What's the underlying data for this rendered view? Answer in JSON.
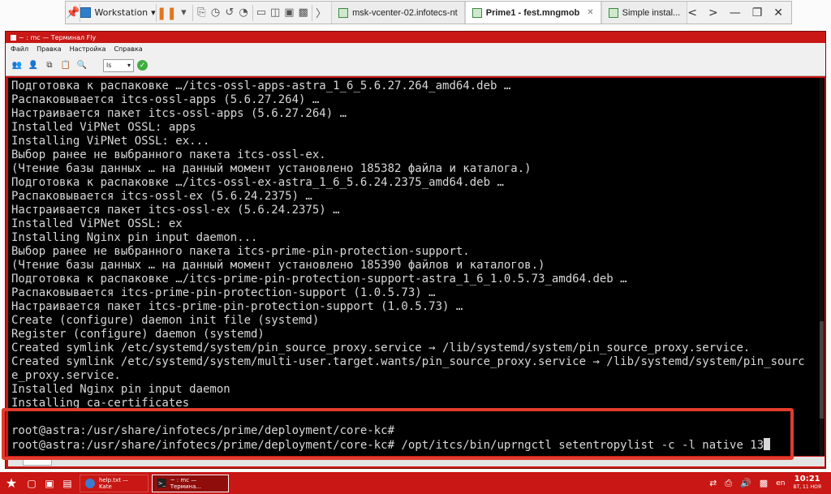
{
  "workstation_toolbar": {
    "menu_label": "Workstation",
    "tabs": [
      {
        "label": "msk-vcenter-02.infotecs-nt"
      },
      {
        "label": "Prime1 - fest.mngmob"
      },
      {
        "label": "Simple instal..."
      }
    ]
  },
  "window": {
    "title": "~ : mc — Терминал Fly",
    "menu": [
      "Файл",
      "Правка",
      "Настройка",
      "Справка"
    ],
    "encoding": "ls"
  },
  "terminal": {
    "lines": [
      "Подготовка к распаковке …/itcs-ossl-apps-astra_1_6_5.6.27.264_amd64.deb …",
      "Распаковывается itcs-ossl-apps (5.6.27.264) …",
      "Настраивается пакет itcs-ossl-apps (5.6.27.264) …",
      "Installed ViPNet OSSL: apps",
      "Installing ViPNet OSSL: ex...",
      "Выбор ранее не выбранного пакета itcs-ossl-ex.",
      "(Чтение базы данных … на данный момент установлено 185382 файла и каталога.)",
      "Подготовка к распаковке …/itcs-ossl-ex-astra_1_6_5.6.24.2375_amd64.deb …",
      "Распаковывается itcs-ossl-ex (5.6.24.2375) …",
      "Настраивается пакет itcs-ossl-ex (5.6.24.2375) …",
      "Installed ViPNet OSSL: ex",
      "Installing Nginx pin input daemon...",
      "Выбор ранее не выбранного пакета itcs-prime-pin-protection-support.",
      "(Чтение базы данных … на данный момент установлено 185390 файлов и каталогов.)",
      "Подготовка к распаковке …/itcs-prime-pin-protection-support-astra_1_6_1.0.5.73_amd64.deb …",
      "Распаковывается itcs-prime-pin-protection-support (1.0.5.73) …",
      "Настраивается пакет itcs-prime-pin-protection-support (1.0.5.73) …",
      "Create (configure) daemon init file (systemd)",
      "Register (configure) daemon (systemd)",
      "Created symlink /etc/systemd/system/pin_source_proxy.service → /lib/systemd/system/pin_source_proxy.service.",
      "Created symlink /etc/systemd/system/multi-user.target.wants/pin_source_proxy.service → /lib/systemd/system/pin_sourc",
      "e_proxy.service.",
      "Installed Nginx pin input daemon",
      "Installing ca-certificates"
    ],
    "prompt": "root@astra:/usr/share/infotecs/prime/deployment/core-kc#",
    "command": " /opt/itcs/bin/uprngctl setentropylist -c -l native 13"
  },
  "taskbar": {
    "tasks": [
      {
        "label": "help.txt — Kate"
      },
      {
        "label": "~ : mc — Термина..."
      }
    ],
    "lang": "en",
    "time": "10:21",
    "date": "ВТ, 11 НОЯ"
  }
}
